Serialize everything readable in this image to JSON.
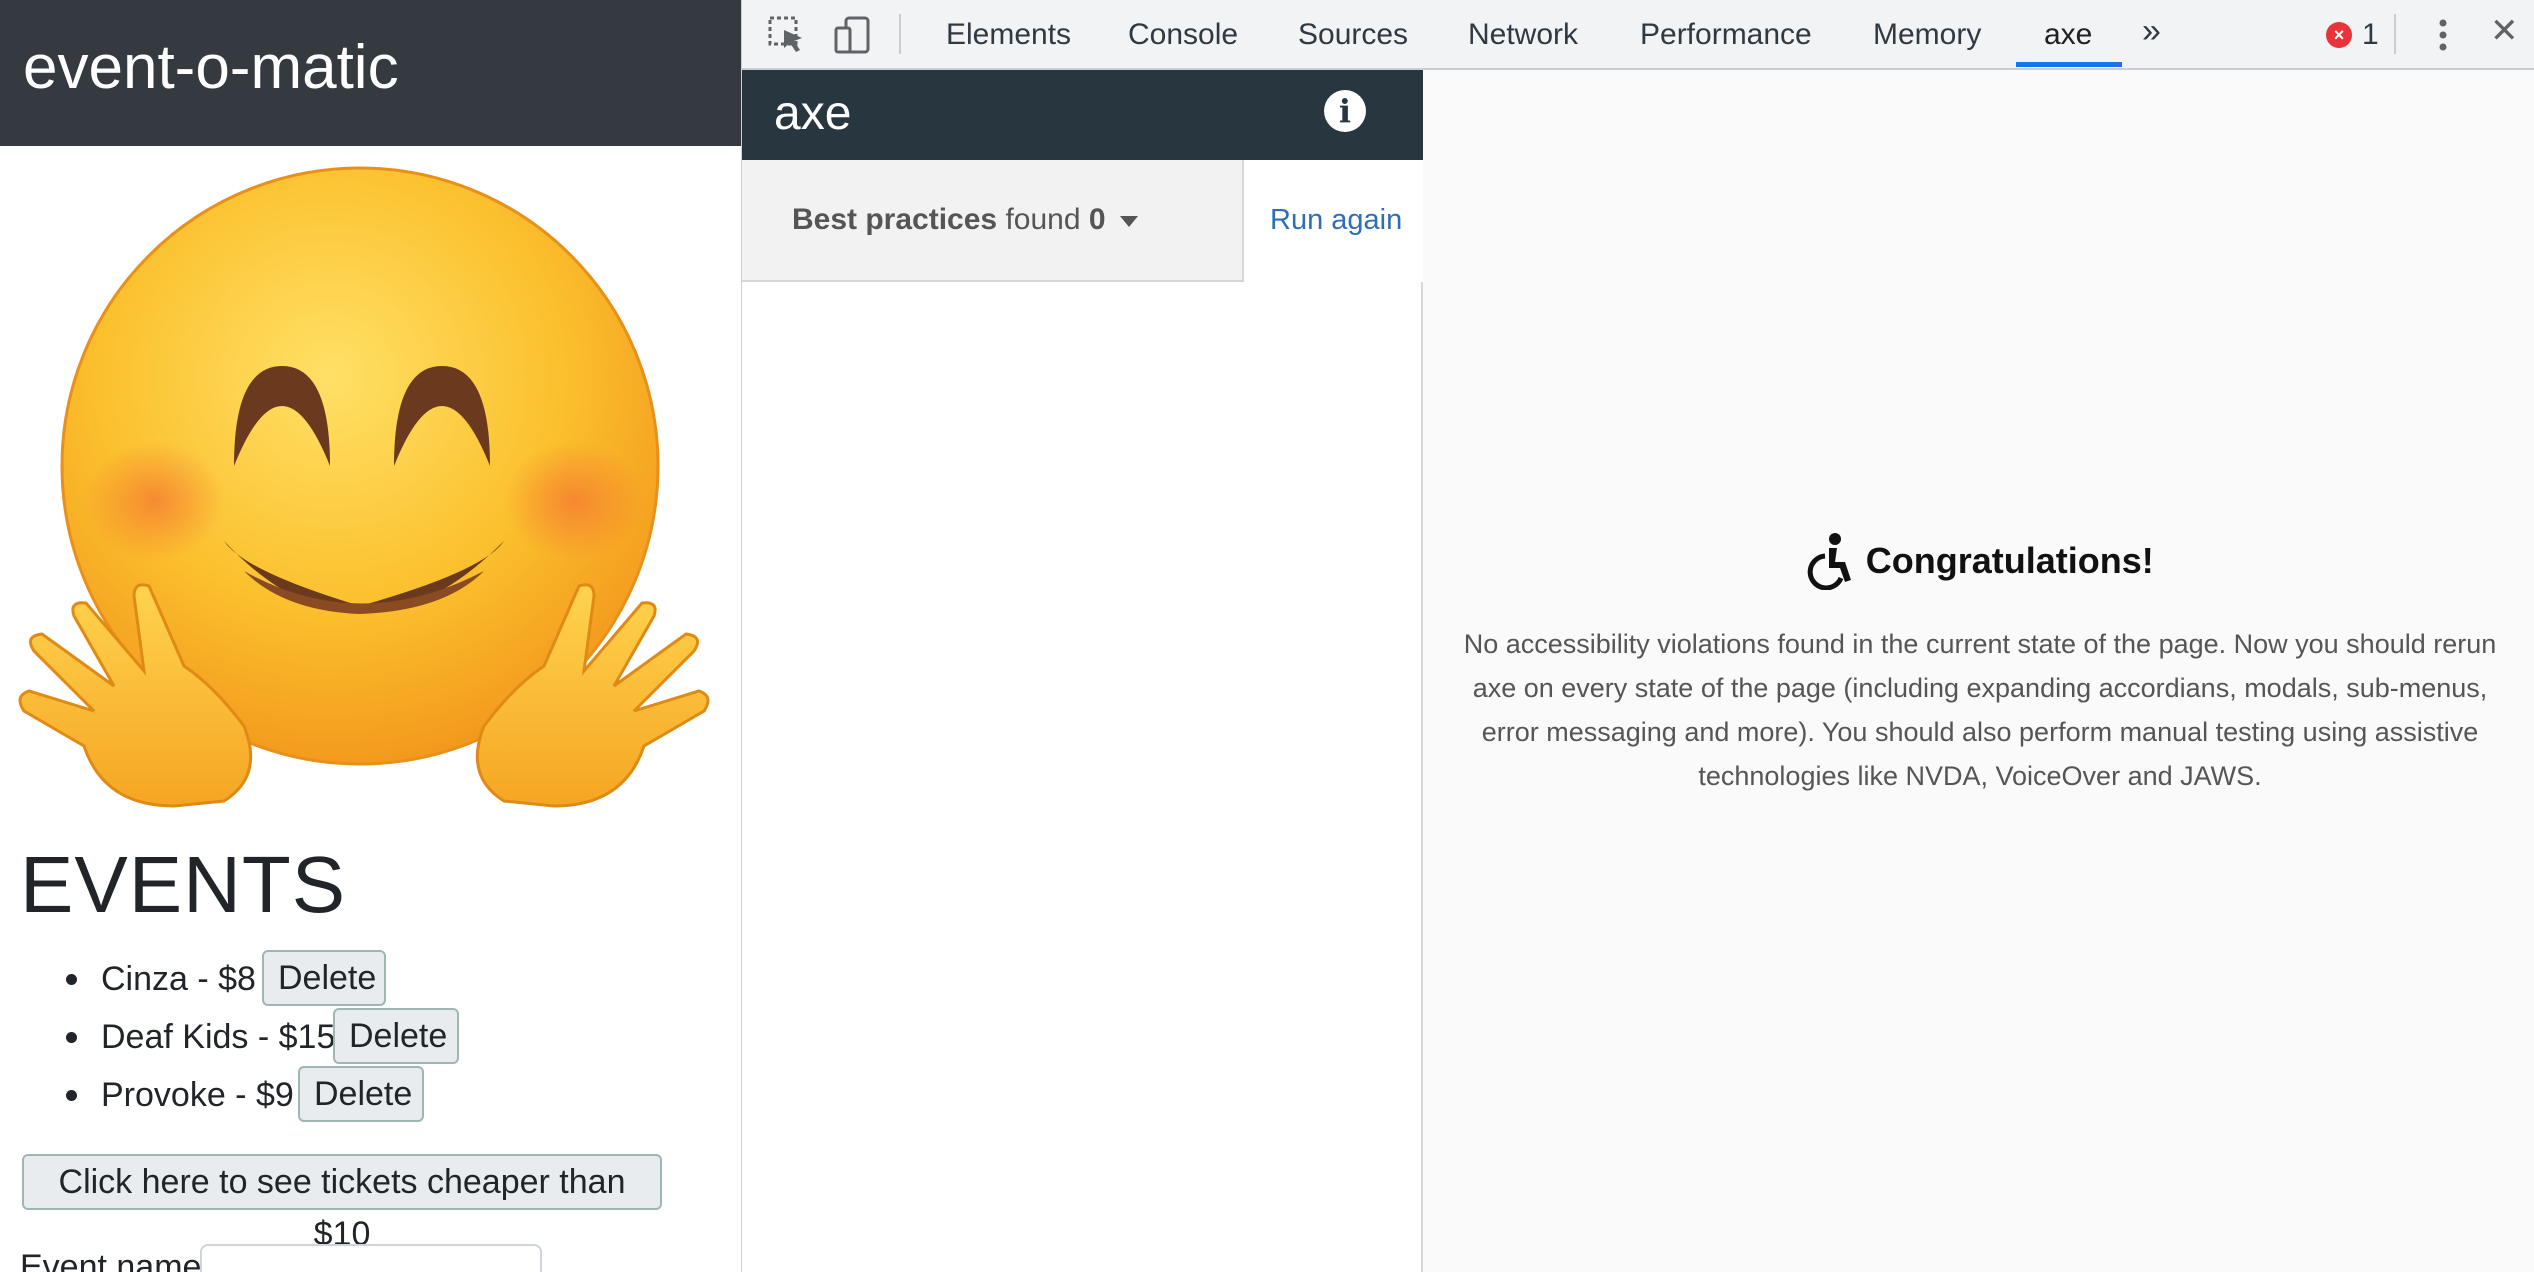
{
  "site": {
    "title": "event-o-matic",
    "events_heading": "EVENTS",
    "events": [
      {
        "label": "Cinza - $8",
        "delete_label": "Delete"
      },
      {
        "label": "Deaf Kids - $15",
        "delete_label": "Delete"
      },
      {
        "label": "Provoke - $9",
        "delete_label": "Delete"
      }
    ],
    "cheap_button_label": "Click here to see tickets cheaper than $10",
    "event_name_label": "Event name"
  },
  "devtools": {
    "tabs": [
      "Elements",
      "Console",
      "Sources",
      "Network",
      "Performance",
      "Memory",
      "axe"
    ],
    "active_tab": "axe",
    "more_tabs_glyph": "»",
    "error_count": "1",
    "close_glyph": "✕",
    "accent_color": "#1a73e8"
  },
  "axe": {
    "title": "axe",
    "summary_category": "Best practices",
    "summary_found": "found",
    "summary_count": "0",
    "run_again_label": "Run again",
    "congrats_title": "Congratulations!",
    "congrats_body": "No accessibility violations found in the current state of the page. Now you should rerun axe on every state of the page (including expanding accordians, modals, sub-menus, error messaging and more). You should also perform manual testing using assistive technologies like NVDA, VoiceOver and JAWS.",
    "header_color": "#283640",
    "link_color": "#2f6eb5"
  }
}
